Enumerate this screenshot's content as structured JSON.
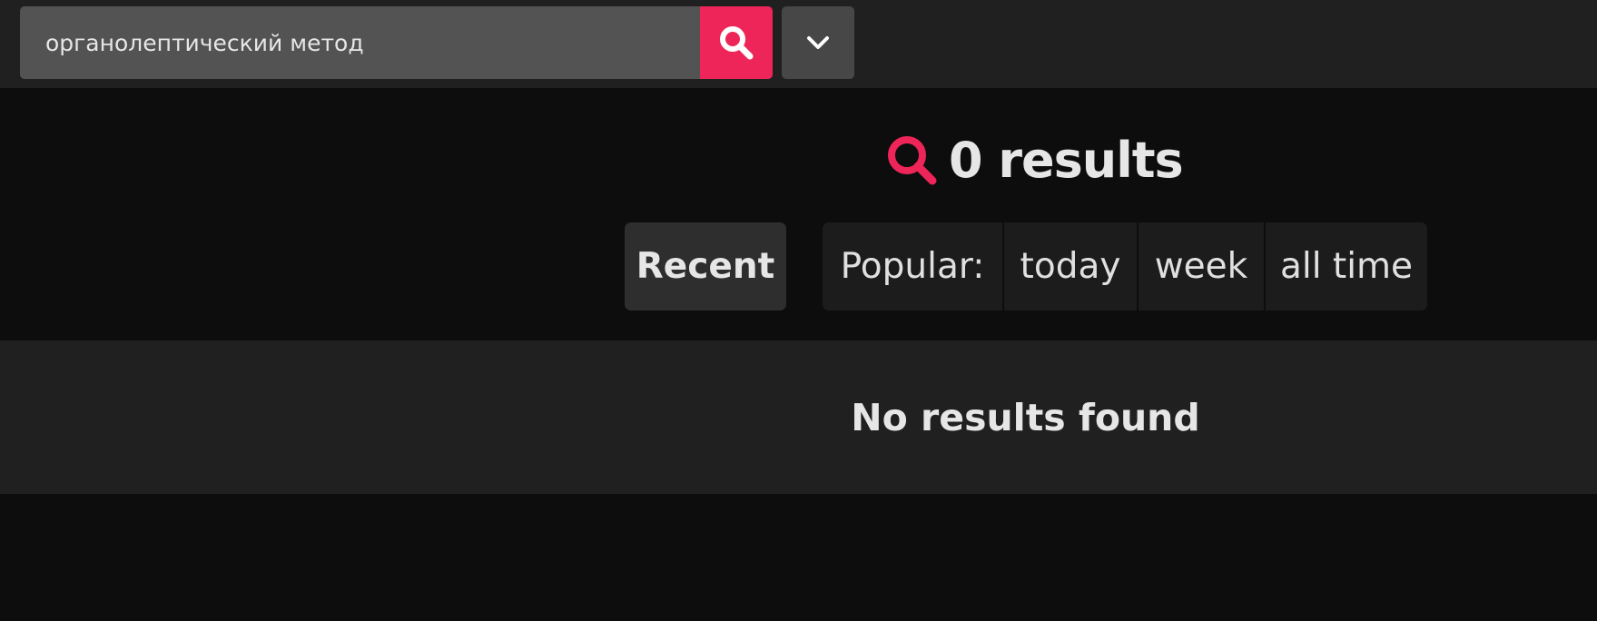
{
  "search": {
    "query": "органолептический метод",
    "submit_icon": "search-icon",
    "dropdown_icon": "chevron-down-icon"
  },
  "results": {
    "title": "0 results",
    "icon": "search-icon"
  },
  "sort": {
    "recent_label": "Recent",
    "popular_label": "Popular:",
    "popular_options": [
      "today",
      "week",
      "all time"
    ]
  },
  "empty_state": {
    "message": "No results found"
  },
  "colors": {
    "accent": "#ee2558",
    "topbar_bg": "#202020",
    "page_bg": "#0d0d0d",
    "input_bg": "#535353",
    "text": "#e6e6e6"
  }
}
